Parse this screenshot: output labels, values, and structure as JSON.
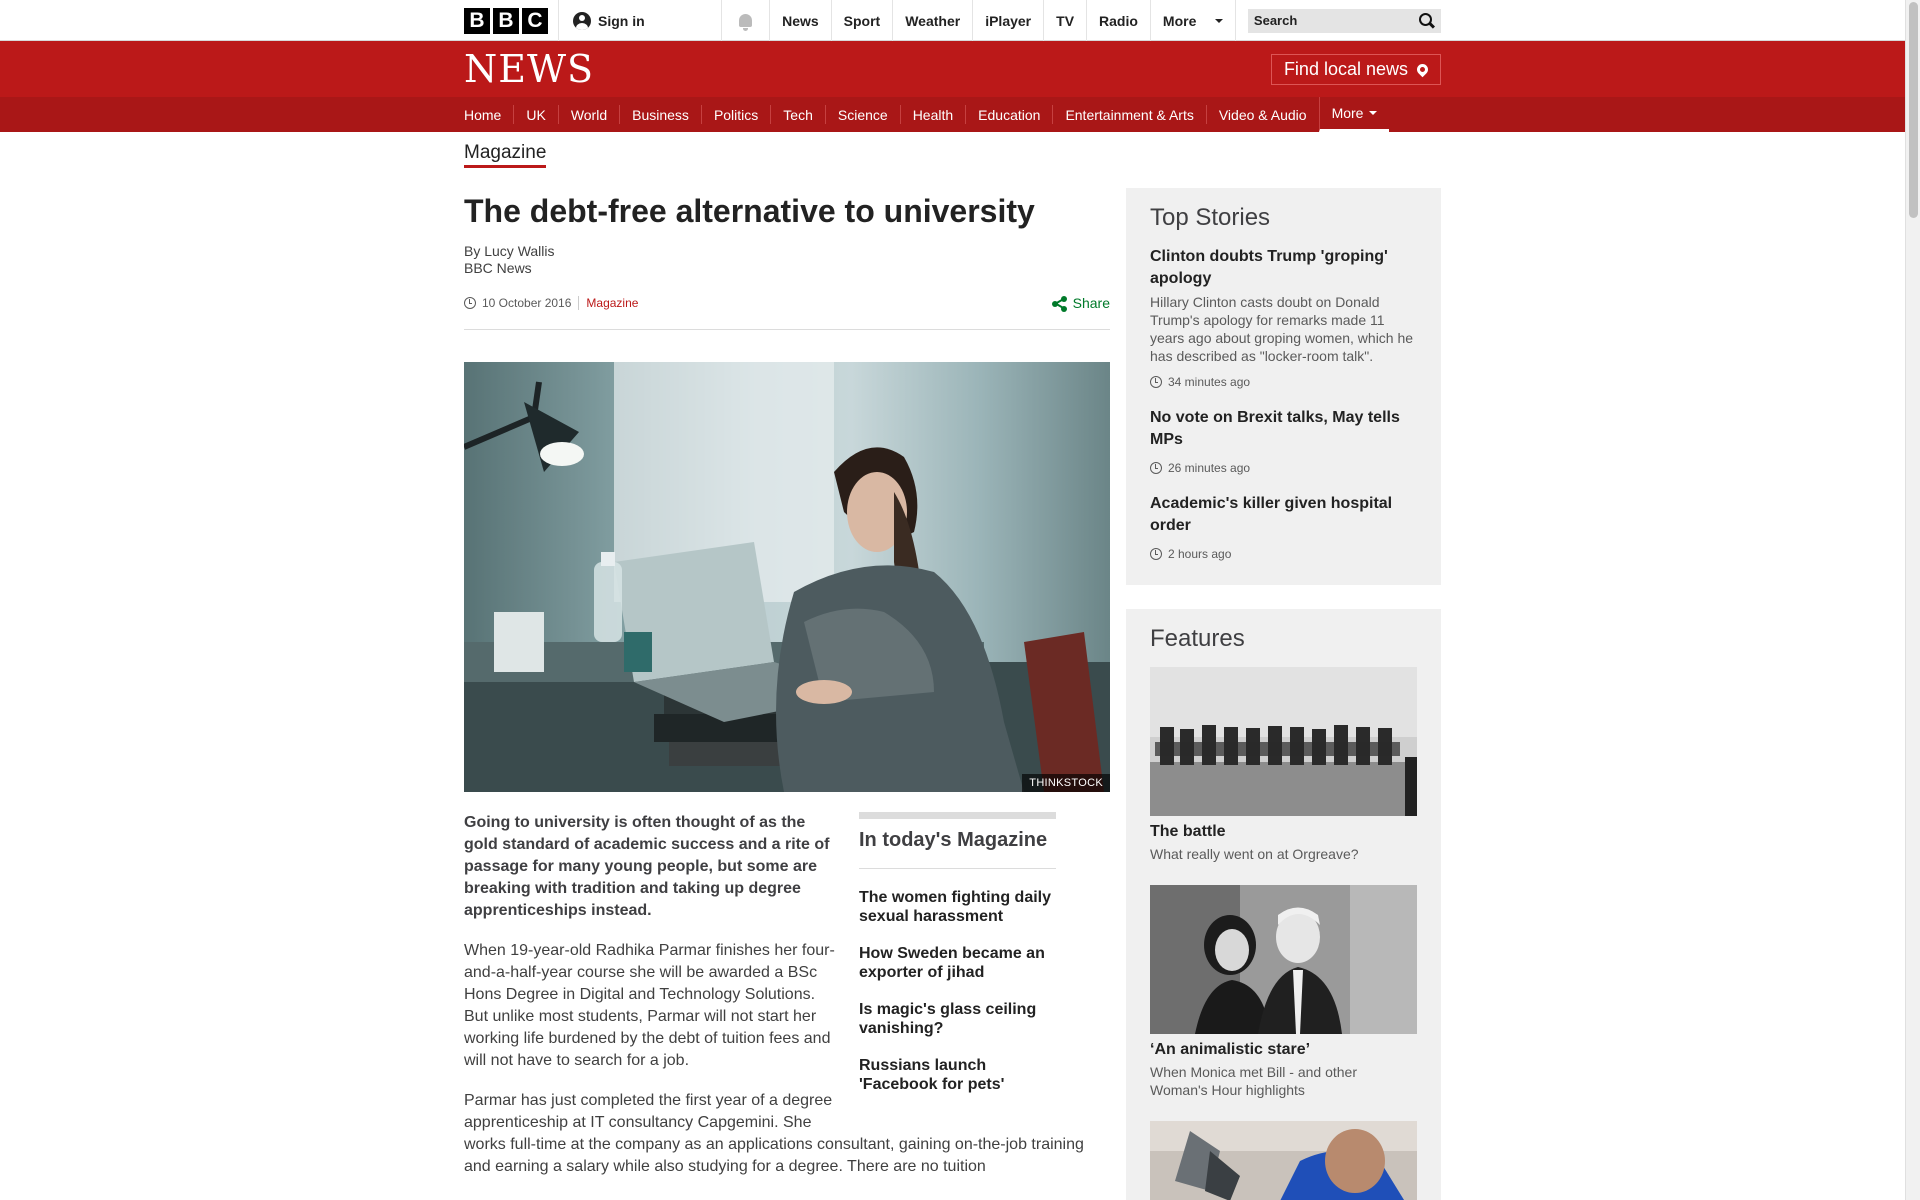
{
  "topbar": {
    "logo_letters": [
      "B",
      "B",
      "C"
    ],
    "signin_label": "Sign in",
    "nav": [
      "News",
      "Sport",
      "Weather",
      "iPlayer",
      "TV",
      "Radio"
    ],
    "more_label": "More",
    "search_placeholder": "Search"
  },
  "header": {
    "logo": "NEWS",
    "local_news": "Find local news"
  },
  "section_nav": {
    "items": [
      "Home",
      "UK",
      "World",
      "Business",
      "Politics",
      "Tech",
      "Science",
      "Health",
      "Education",
      "Entertainment & Arts",
      "Video & Audio"
    ],
    "more_label": "More"
  },
  "section_label": "Magazine",
  "article": {
    "title": "The debt-free alternative to university",
    "author": "By Lucy Wallis",
    "outlet": "BBC News",
    "date": "10 October 2016",
    "category": "Magazine",
    "share_label": "Share",
    "image_credit": "THINKSTOCK",
    "intro": "Going to university is often thought of as the gold standard of academic success and a rite of passage for many young people, but some are breaking with tradition and taking up degree apprenticeships instead.",
    "para1": "When 19-year-old Radhika Parmar finishes her four-and-a-half-year course she will be awarded a BSc Hons Degree in Digital and Technology Solutions. But unlike most students, Parmar will not start her working life burdened by the debt of tuition fees and will not have to search for a job.",
    "para2_a": "Parmar has just completed the first year of a degree apprenticeship at IT consultancy Capgemini. She",
    "para2_b": "works full-time at the company as an applications consultant, gaining on-the-job training and earning a salary while also studying for a degree. There are no tuition"
  },
  "magazine_box": {
    "title": "In today's Magazine",
    "items": [
      "The women fighting daily sexual harassment",
      "How Sweden became an exporter of jihad",
      "Is magic's glass ceiling vanishing?",
      "Russians launch 'Facebook for pets'"
    ]
  },
  "top_stories": {
    "title": "Top Stories",
    "items": [
      {
        "headline": "Clinton doubts Trump 'groping' apology",
        "summary": "Hillary Clinton casts doubt on Donald Trump's apology for remarks made 11 years ago about groping women, which he has described as \"locker-room talk\".",
        "time": "34 minutes ago"
      },
      {
        "headline": "No vote on Brexit talks, May tells MPs",
        "summary": "",
        "time": "26 minutes ago"
      },
      {
        "headline": "Academic's killer given hospital order",
        "summary": "",
        "time": "2 hours ago"
      }
    ]
  },
  "features": {
    "title": "Features",
    "items": [
      {
        "headline": "The battle",
        "summary": "What really went on at Orgreave?"
      },
      {
        "headline": "‘An animalistic stare’",
        "summary": "When Monica met Bill - and other Woman's Hour highlights"
      }
    ]
  },
  "colors": {
    "brand_red": "#bb1919",
    "nav_red": "#a91717",
    "share_green": "#007a2a"
  }
}
